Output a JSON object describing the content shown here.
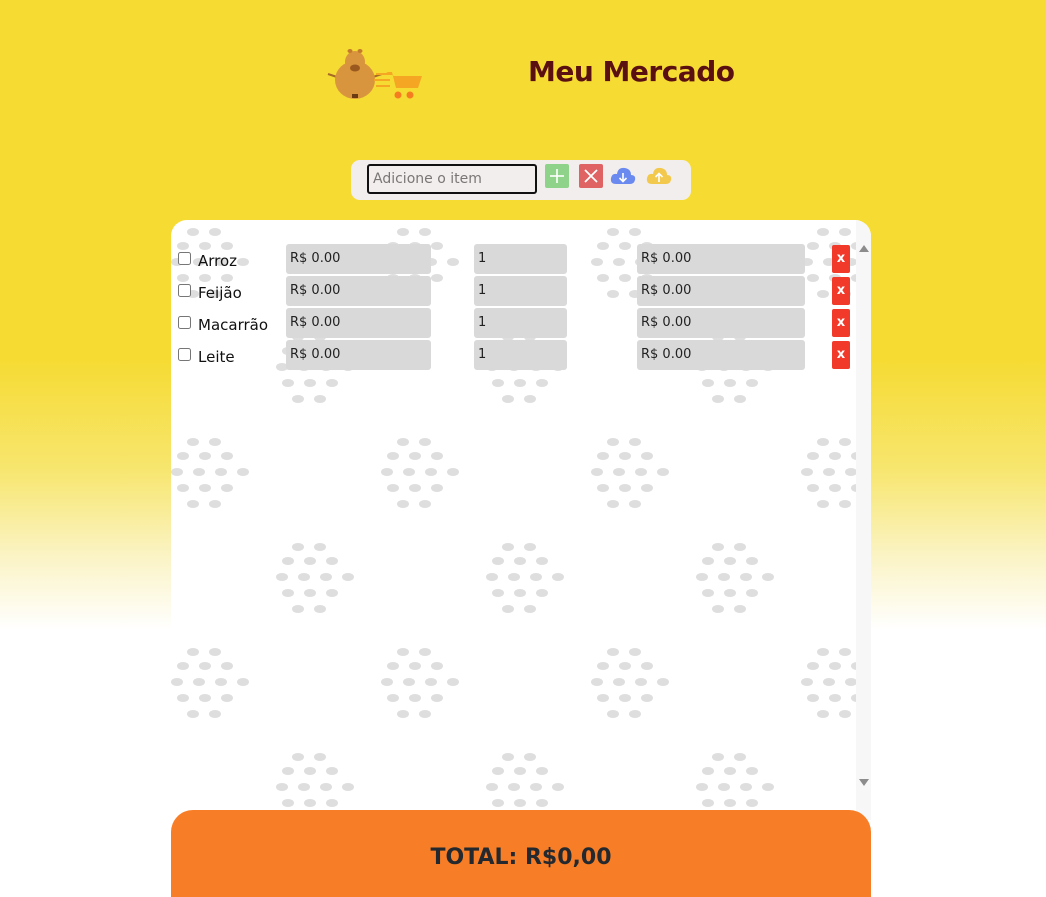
{
  "header": {
    "title": "Meu Mercado",
    "logo_icon": "capybara-cart-logo"
  },
  "toolbar": {
    "input_placeholder": "Adicione o item",
    "input_value": "",
    "add_icon": "plus-icon",
    "clear_icon": "x-icon",
    "download_icon": "cloud-download-icon",
    "upload_icon": "cloud-upload-icon"
  },
  "items": [
    {
      "name": "Arroz",
      "price": "R$ 0.00",
      "qty": "1",
      "subtotal": "R$ 0.00",
      "delete": "x",
      "checked": false
    },
    {
      "name": "Feijão",
      "price": "R$ 0.00",
      "qty": "1",
      "subtotal": "R$ 0.00",
      "delete": "x",
      "checked": false
    },
    {
      "name": "Macarrão",
      "price": "R$ 0.00",
      "qty": "1",
      "subtotal": "R$ 0.00",
      "delete": "x",
      "checked": false
    },
    {
      "name": "Leite",
      "price": "R$ 0.00",
      "qty": "1",
      "subtotal": "R$ 0.00",
      "delete": "x",
      "checked": false
    }
  ],
  "footer": {
    "total": "TOTAL: R$0,00"
  },
  "colors": {
    "background_top": "#f6db33",
    "title": "#5a1010",
    "footer": "#f77e26",
    "delete_button": "#f23a2a",
    "add_button": "#8fd38a",
    "clear_button": "#e06363",
    "download_icon": "#6b8af0",
    "upload_icon": "#f2c94c"
  }
}
